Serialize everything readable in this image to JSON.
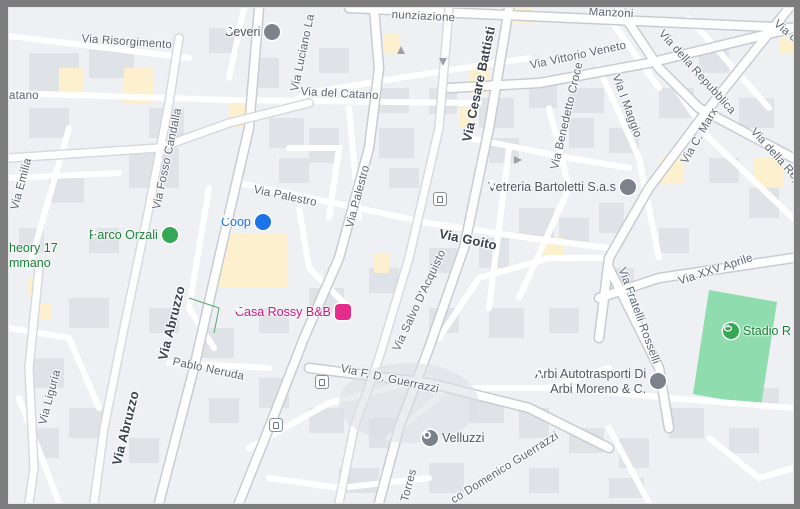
{
  "streets": [
    {
      "id": "risorgimento",
      "text": "Via Risorgimento",
      "bold": false
    },
    {
      "id": "luciano",
      "text": "Via Luciano La",
      "bold": false
    },
    {
      "id": "nunziazione",
      "text": "nunziazione",
      "bold": false
    },
    {
      "id": "manzoni",
      "text": "Manzoni",
      "bold": false
    },
    {
      "id": "vittorio-veneto",
      "text": "Via Vittorio Veneto",
      "bold": false
    },
    {
      "id": "repubblica-1",
      "text": "Via della Repubblica",
      "bold": false
    },
    {
      "id": "repubblica-2",
      "text": "Via della Repubb",
      "bold": false
    },
    {
      "id": "repubblica-3",
      "text": "Via della Re",
      "bold": false
    },
    {
      "id": "catano-left",
      "text": "atano",
      "bold": false
    },
    {
      "id": "del-catano",
      "text": "Via del Catano",
      "bold": false
    },
    {
      "id": "cesare-battisti",
      "text": "Via Cesare Battisti",
      "bold": false
    },
    {
      "id": "benedetto-croce",
      "text": "Via Benedetto Croce",
      "bold": false
    },
    {
      "id": "i-maggio",
      "text": "Via I Maggio",
      "bold": false
    },
    {
      "id": "c-marx",
      "text": "Via C. Marx",
      "bold": false
    },
    {
      "id": "emilia",
      "text": "Via Emilia",
      "bold": false
    },
    {
      "id": "fosso-candalla",
      "text": "Via Fosso Candalla",
      "bold": false
    },
    {
      "id": "palestro-diag",
      "text": "Via Palestro",
      "bold": false
    },
    {
      "id": "palestro-horiz",
      "text": "Via Palestro",
      "bold": false
    },
    {
      "id": "goito",
      "text": "Via Goito",
      "bold": true
    },
    {
      "id": "xxv-aprile",
      "text": "Via XXV Aprile",
      "bold": false
    },
    {
      "id": "fratelli-rosselli",
      "text": "Via Fratelli Rosselli",
      "bold": false
    },
    {
      "id": "abruzzo-1",
      "text": "Via Abruzzo",
      "bold": false
    },
    {
      "id": "abruzzo-2",
      "text": "Via Abruzzo",
      "bold": false
    },
    {
      "id": "pablo-neruda",
      "text": "Pablo Neruda",
      "bold": false
    },
    {
      "id": "salvo-d-acquisto",
      "text": "Via Salvo D'Acquisto",
      "bold": false
    },
    {
      "id": "fd-guerrazzi",
      "text": "Via F. D. Guerrazzi",
      "bold": false
    },
    {
      "id": "domenico-guerrazzi",
      "text": "co Domenico Guerrazzi",
      "bold": false
    },
    {
      "id": "torres",
      "text": "Torres",
      "bold": false
    },
    {
      "id": "liguria",
      "text": "Via Liguria",
      "bold": false
    }
  ],
  "places": {
    "severi": {
      "name": "Severi",
      "icon": "place-pin-icon"
    },
    "coop": {
      "name": "Coop",
      "icon": "shopping-cart-icon"
    },
    "parco_orzali": {
      "name": "Parco Orzali",
      "icon": "tree-icon"
    },
    "theory": {
      "line1": "heory 17",
      "line2": "mmano"
    },
    "casa_rossy": {
      "name": "Casa Rossy B&B",
      "icon": "bed-icon"
    },
    "vetreria": {
      "name": "Vetreria Bartoletti S.a.s",
      "icon": "place-pin-icon"
    },
    "arbi": {
      "line1": "Arbi Autotrasporti Di",
      "line2": "Arbi Moreno & C.",
      "icon": "place-pin-icon"
    },
    "velluzzi": {
      "name": "Velluzzi",
      "icon": "place-pin-icon"
    },
    "stadio": {
      "name": "Stadio R",
      "icon": "stadium-icon"
    }
  },
  "colors": {
    "background": "#eef0f4",
    "road": "#ffffff",
    "major_road_outline": "#c7ccd3",
    "building": "#dfe2e7",
    "commercial": "#fdf0cf",
    "park": "#8fdcae",
    "frame": "#7d7d7d"
  }
}
